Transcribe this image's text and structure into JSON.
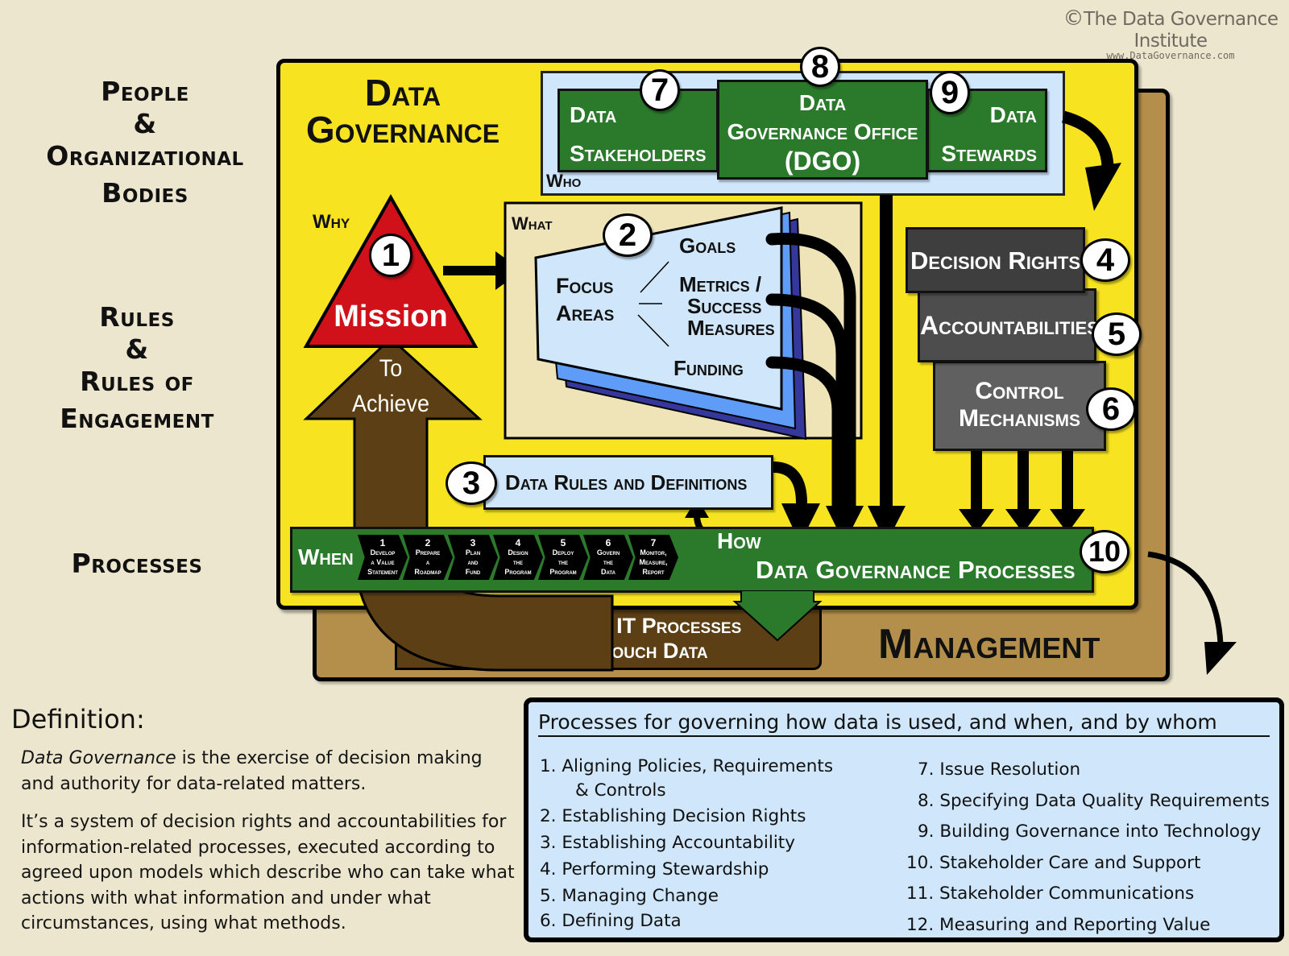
{
  "branding": {
    "copyright_symbol": "©",
    "institute": "The Data Governance Institute",
    "website": "www.DataGovernance.com"
  },
  "side_labels": {
    "people": [
      "People",
      "&",
      "Organizational",
      "Bodies"
    ],
    "rules": [
      "Rules",
      "&",
      "Rules of",
      "Engagement"
    ],
    "processes": "Processes"
  },
  "diagram": {
    "title_line1": "Data",
    "title_line2": "Governance",
    "why_label": "Why",
    "what_label": "What",
    "who_label": "Who",
    "when_label": "When",
    "how_label": "How",
    "mission": {
      "number": "1",
      "label": "Mission"
    },
    "to_achieve": [
      "To",
      "Achieve"
    ],
    "focus_areas": {
      "number": "2",
      "label": [
        "Focus",
        "Areas"
      ],
      "items": [
        "Goals",
        "Metrics /",
        "Success",
        "Measures",
        "Funding"
      ]
    },
    "rules": {
      "number": "3",
      "label": "Data Rules and Definitions"
    },
    "decision_rights": {
      "number": "4",
      "label": "Decision Rights"
    },
    "accountabilities": {
      "number": "5",
      "label": "Accountabilities"
    },
    "control_mechanisms": {
      "number": "6",
      "label": [
        "Control",
        "Mechanisms"
      ]
    },
    "stakeholders": {
      "number": "7",
      "label": [
        "Data",
        "Stakeholders"
      ]
    },
    "dgo": {
      "number": "8",
      "label": [
        "Data",
        "Governance Office",
        "(DGO)"
      ]
    },
    "stewards": {
      "number": "9",
      "label": [
        "Data",
        "Stewards"
      ]
    },
    "processes": {
      "number": "10",
      "label": "Data Governance Processes"
    },
    "steps": [
      {
        "n": "1",
        "lines": [
          "Develop",
          "a Value",
          "Statement"
        ]
      },
      {
        "n": "2",
        "lines": [
          "Prepare",
          "a",
          "Roadmap"
        ]
      },
      {
        "n": "3",
        "lines": [
          "Plan",
          "and",
          "Fund"
        ]
      },
      {
        "n": "4",
        "lines": [
          "Design",
          "the",
          "Program"
        ]
      },
      {
        "n": "5",
        "lines": [
          "Deploy",
          "the",
          "Program"
        ]
      },
      {
        "n": "6",
        "lines": [
          "Govern",
          "the",
          "Data"
        ]
      },
      {
        "n": "7",
        "lines": [
          "Monitor,",
          "Measure,",
          "Report"
        ]
      }
    ],
    "business_it": [
      "Business / IT Processes",
      "That Touch Data"
    ],
    "management": "Management"
  },
  "colors": {
    "yellow": "#f7e31f",
    "green": "#2b7a2b",
    "red": "#d0111a",
    "brown": "#5c3f14",
    "tan": "#b38f4b",
    "light_blue": "#cfe6fb",
    "dark_gray": "#3e3e3e",
    "mid_gray": "#4d4d4d",
    "light_gray": "#606060"
  },
  "definition": {
    "title": "Definition:",
    "term": "Data Governance",
    "para1_rest": " is the exercise of decision making and authority for data-related matters.",
    "para2": "It’s a system of decision rights and accountabilities for information-related processes, executed according to agreed upon models which describe who can take what actions with what information and under what circumstances, using what methods."
  },
  "processes_box": {
    "title": "Processes for governing how data is used, and when, and by whom",
    "left": [
      "1. Aligning Policies, Requirements",
      "& Controls",
      "2. Establishing Decision Rights",
      "3. Establishing Accountability",
      "4. Performing Stewardship",
      "5. Managing Change",
      "6. Defining Data"
    ],
    "right": [
      "7. Issue Resolution",
      "8. Specifying Data Quality Requirements",
      "9. Building Governance into Technology",
      "10. Stakeholder Care and Support",
      "11. Stakeholder Communications",
      "12. Measuring and Reporting Value"
    ]
  }
}
